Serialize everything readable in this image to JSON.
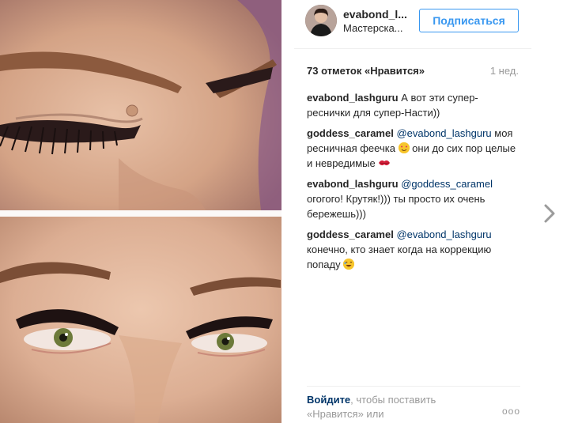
{
  "header": {
    "username": "evabond_l...",
    "location": "Мастерска...",
    "follow_label": "Подписаться"
  },
  "post": {
    "likes": "73 отметок «Нравится»",
    "time": "1 нед."
  },
  "comments": [
    {
      "author": "evabond_lashguru",
      "mention": "",
      "text": " А вот эти супер-реснички для супер-Насти))",
      "emoji": "",
      "tail": ""
    },
    {
      "author": "goddess_caramel",
      "mention": " @evabond_lashguru",
      "text": " моя ресничная феечка ",
      "emoji": "smile",
      "tail": " они до сих пор целые и невредимые "
    },
    {
      "author": "evabond_lashguru",
      "mention": " @goddess_caramel",
      "text": " огогого! Крутяк!))) ты просто их очень бережешь)))",
      "emoji": "",
      "tail": ""
    },
    {
      "author": "goddess_caramel",
      "mention": " @evabond_lashguru",
      "text": " конечно, кто знает когда на коррекцию попаду ",
      "emoji": "grin",
      "tail": ""
    }
  ],
  "footer": {
    "login_link": "Войдите",
    "login_text": ", чтобы поставить «Нравится» или",
    "more": "ooo"
  },
  "icons": {
    "next": "chevron-right-icon",
    "more": "more-options-icon",
    "kiss": "kiss-mark-icon",
    "smile": "heart-eyes-emoji-icon",
    "grin": "grin-emoji-icon"
  },
  "colors": {
    "follow_blue": "#3897f0",
    "link_blue": "#003569",
    "muted": "#999999"
  }
}
